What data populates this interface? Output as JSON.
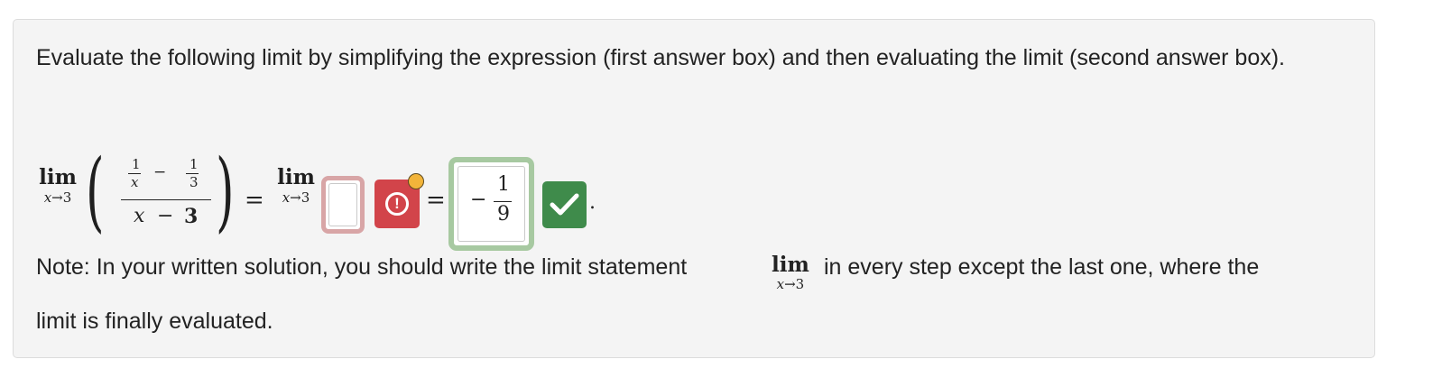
{
  "prompt_text": "Evaluate the following limit by simplifying the expression (first answer box) and then evaluating the limit (second answer box).",
  "expression": {
    "lim_word": "lim",
    "lim_sub_var": "x",
    "lim_sub_arrow": "→",
    "lim_sub_value": "3",
    "inner_num_a_top": "1",
    "inner_num_a_bottom": "x",
    "inner_minus": "−",
    "inner_num_b_top": "1",
    "inner_num_b_bottom": "3",
    "den_var": "x",
    "den_minus": "−",
    "den_value": "3",
    "equals": "="
  },
  "answer1": {
    "value": "",
    "status": "incorrect",
    "icon": "exclamation-circle-icon",
    "icon_glyph": "!"
  },
  "answer2": {
    "sign": "−",
    "num": "1",
    "den": "9",
    "status": "correct",
    "icon": "checkmark-icon"
  },
  "period": ".",
  "note": {
    "before": "Note: In your written solution, you should write the limit statement",
    "after": "in every step except the last one, where the",
    "line2": "limit is finally evaluated."
  },
  "colors": {
    "incorrect": "#d2444a",
    "incorrect_border": "#d8a5a6",
    "correct": "#3f8b4b",
    "correct_border": "#a7c9a1",
    "warning_dot": "#f2b43a"
  }
}
